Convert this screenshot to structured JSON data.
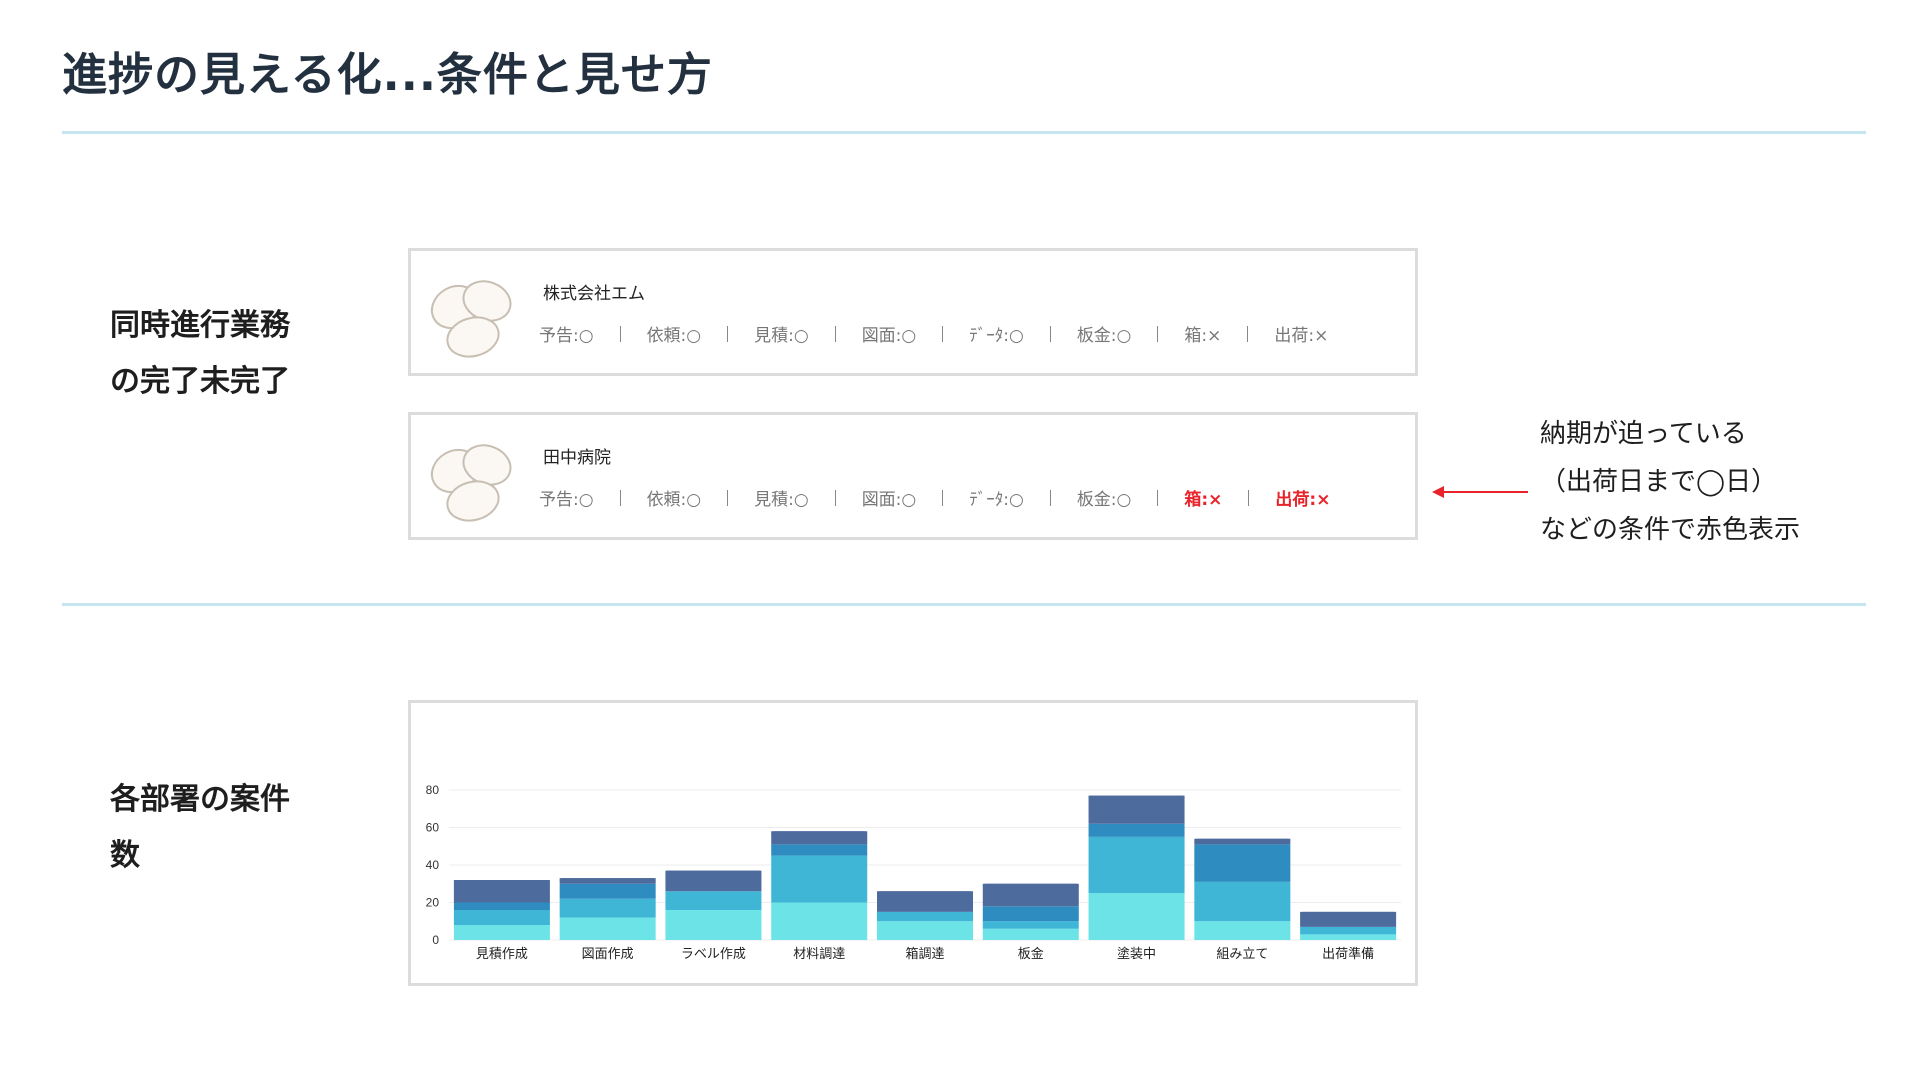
{
  "page": {
    "title": "進捗の見える化...条件と見せ方",
    "section1_label": "同時進行業務\nの完了未完了",
    "section2_label": "各部署の案件\n数"
  },
  "cards": [
    {
      "name": "株式会社エム",
      "statuses": [
        {
          "text": "予告:○",
          "alert": false
        },
        {
          "text": "依頼:○",
          "alert": false
        },
        {
          "text": "見積:○",
          "alert": false
        },
        {
          "text": "図面:○",
          "alert": false
        },
        {
          "text": "ﾃﾞｰﾀ:○",
          "alert": false
        },
        {
          "text": "板金:○",
          "alert": false
        },
        {
          "text": "箱:×",
          "alert": false
        },
        {
          "text": "出荷:×",
          "alert": false
        }
      ]
    },
    {
      "name": "田中病院",
      "statuses": [
        {
          "text": "予告:○",
          "alert": false
        },
        {
          "text": "依頼:○",
          "alert": false
        },
        {
          "text": "見積:○",
          "alert": false
        },
        {
          "text": "図面:○",
          "alert": false
        },
        {
          "text": "ﾃﾞｰﾀ:○",
          "alert": false
        },
        {
          "text": "板金:○",
          "alert": false
        },
        {
          "text": "箱:×",
          "alert": true
        },
        {
          "text": "出荷:×",
          "alert": true
        }
      ]
    }
  ],
  "annotation": {
    "line1": "納期が迫っている",
    "line2": "（出荷日まで◯日）",
    "line3": "などの条件で赤色表示"
  },
  "colors": {
    "alert": "#e8232a",
    "divider": "#c5e6f1",
    "series": [
      "#6ce3e6",
      "#3fb6d6",
      "#2e8cc0",
      "#4d6b9d"
    ]
  },
  "chart_data": {
    "type": "bar",
    "stacked": true,
    "categories": [
      "見積作成",
      "図面作成",
      "ラベル作成",
      "材料調達",
      "箱調達",
      "板金",
      "塗装中",
      "組み立て",
      "出荷準備"
    ],
    "series": [
      {
        "values": [
          8,
          12,
          16,
          20,
          10,
          6,
          25,
          10,
          3
        ]
      },
      {
        "values": [
          8,
          10,
          10,
          25,
          5,
          4,
          30,
          21,
          4
        ]
      },
      {
        "values": [
          4,
          8,
          0,
          6,
          0,
          8,
          7,
          20,
          0
        ]
      },
      {
        "values": [
          12,
          3,
          11,
          7,
          11,
          12,
          15,
          3,
          8
        ]
      }
    ],
    "yticks": [
      0,
      20,
      40,
      60,
      80
    ],
    "ylim": [
      0,
      80
    ],
    "grid": true
  }
}
